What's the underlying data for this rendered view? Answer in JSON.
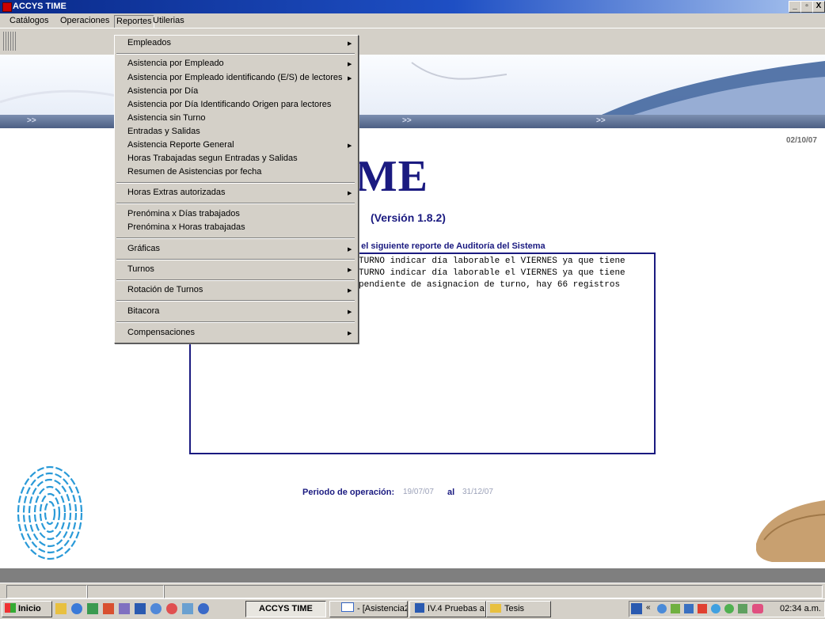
{
  "window": {
    "title": "ACCYS TIME",
    "controls": [
      "_",
      "Ʒ",
      "X"
    ]
  },
  "menubar": {
    "items": [
      "Catálogos",
      "Operaciones",
      "Reportes",
      "Utilerias"
    ]
  },
  "reportes_menu": {
    "items": [
      {
        "label": "Empleados",
        "submenu": true
      },
      {
        "label": "Asistencia por Empleado",
        "submenu": true
      },
      {
        "label": "Asistencia por Empleado identificando (E/S) de lectores",
        "submenu": true
      },
      {
        "label": "Asistencia por Día",
        "submenu": false
      },
      {
        "label": "Asistencia por Día Identificando Origen para lectores",
        "submenu": false
      },
      {
        "label": "Asistencia sin Turno",
        "submenu": false
      },
      {
        "label": "Entradas y Salidas",
        "submenu": false
      },
      {
        "label": "Asistencia Reporte General",
        "submenu": true
      },
      {
        "label": "Horas Trabajadas segun Entradas y Salidas",
        "submenu": false
      },
      {
        "label": "Resumen de Asistencias por fecha",
        "submenu": false
      },
      {
        "label": "Horas Extras autorizadas",
        "submenu": true
      },
      {
        "label": "Prenómina x Días trabajados",
        "submenu": false
      },
      {
        "label": "Prenómina x Horas trabajadas",
        "submenu": false
      },
      {
        "label": "Gráficas",
        "submenu": true
      },
      {
        "label": "Turnos",
        "submenu": true
      },
      {
        "label": "Rotación de Turnos",
        "submenu": true
      },
      {
        "label": "Bitacora",
        "submenu": true
      },
      {
        "label": "Compensaciones",
        "submenu": true
      }
    ]
  },
  "banner": {
    "nav_arrow": ">>"
  },
  "main": {
    "date": "02/10/07",
    "title_visible": "YS TIME",
    "version": "(Versión 1.8.2)",
    "audit_heading": "e el siguiente reporte de Auditoría del Sistema",
    "audit_lines": [
      "TURNO indicar día laborable el VIERNES ya que tiene",
      "TURNO indicar día laborable el VIERNES ya que tiene",
      "pendiente de asignacion de turno, hay 66 registros"
    ],
    "period_label": "Periodo de operación:",
    "period_start": "19/07/07",
    "period_al": "al",
    "period_end": "31/12/07"
  },
  "taskbar": {
    "start_label": "Inicio",
    "tasks": [
      "ACCYS TIME",
      "- [Asistencia2x...",
      "IV.4 Pruebas a ...",
      "Tesis"
    ],
    "clock": "02:34 a.m."
  },
  "colors": {
    "accent": "#1a1a80",
    "titlebar": "#0a2a8a",
    "chrome": "#d4d0c8"
  }
}
